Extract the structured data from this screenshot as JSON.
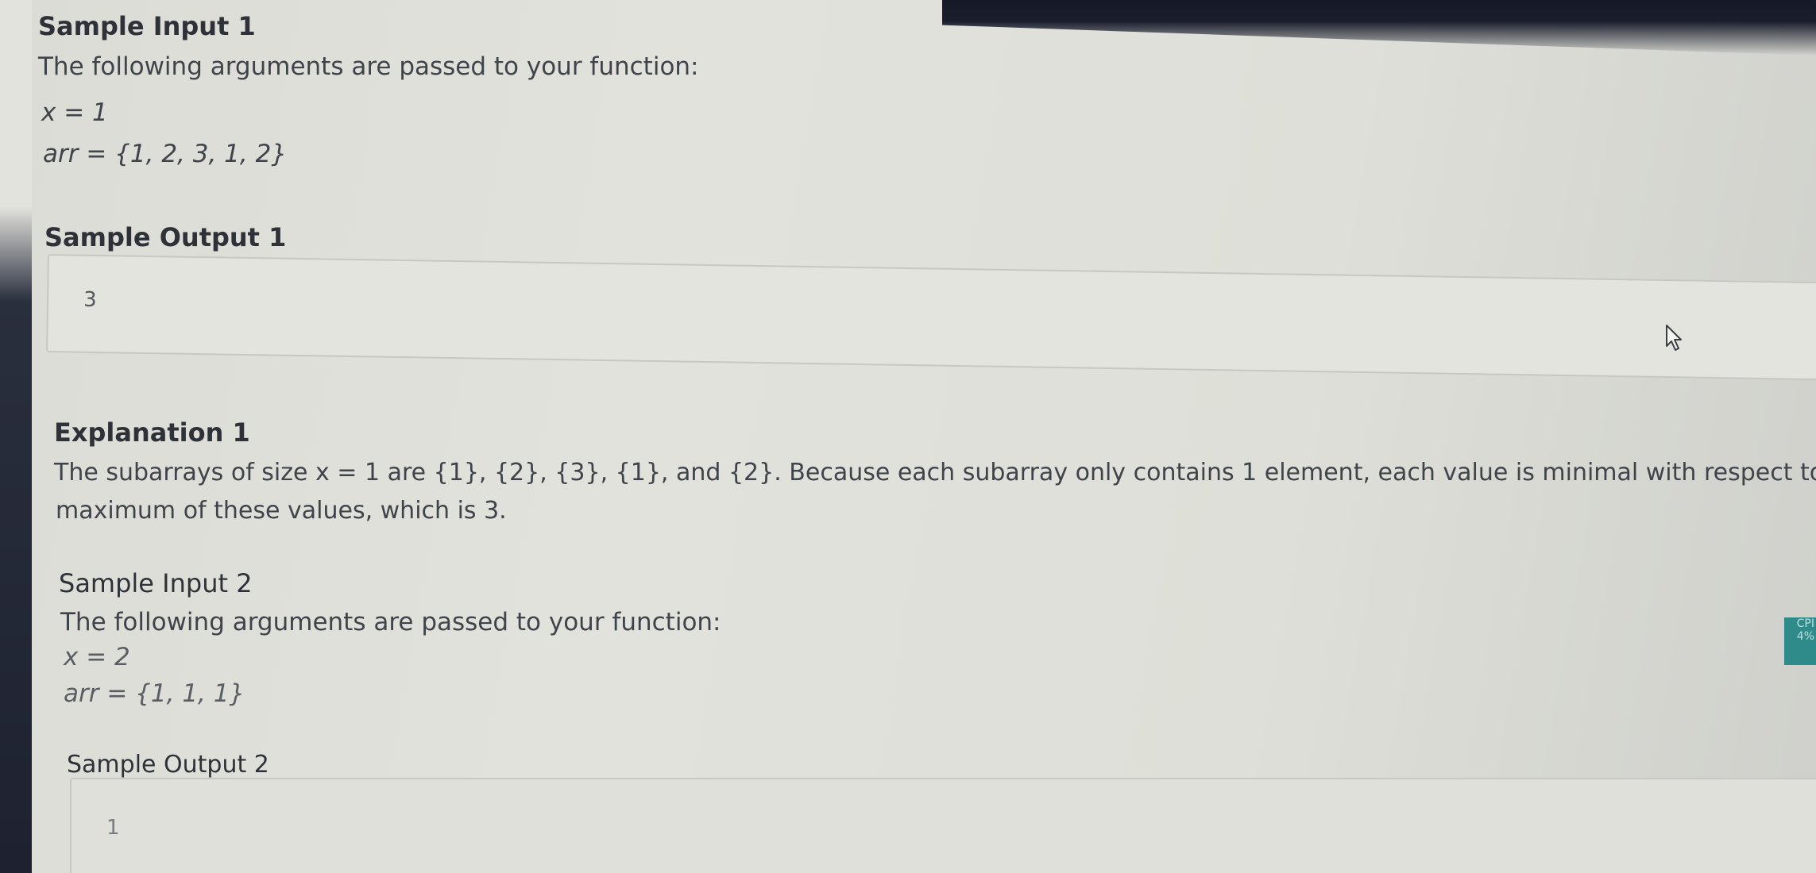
{
  "sample_input_1": {
    "heading": "Sample Input 1",
    "intro": "The following arguments are passed to your function:",
    "x_line": "x = 1",
    "arr_line": "arr = {1, 2, 3, 1, 2}"
  },
  "sample_output_1": {
    "heading": "Sample Output 1",
    "value": "3"
  },
  "explanation_1": {
    "heading": "Explanation 1",
    "line1": "The subarrays of size x = 1 are {1}, {2}, {3}, {1}, and {2}. Because each subarray only contains 1 element, each value is minimal with respect to the subarray it's in. We re",
    "line2": "maximum of these values, which is 3."
  },
  "sample_input_2": {
    "heading": "Sample Input 2",
    "intro": "The following arguments are passed to your function:",
    "x_line": "x = 2",
    "arr_line": "arr = {1, 1, 1}"
  },
  "sample_output_2": {
    "heading": "Sample Output 2",
    "value": "1"
  },
  "side_widget": {
    "line1": "CPI",
    "line2": "4%"
  },
  "colors": {
    "text": "#3f434a",
    "heading": "#2e3238",
    "widget": "#2f8a8a"
  }
}
